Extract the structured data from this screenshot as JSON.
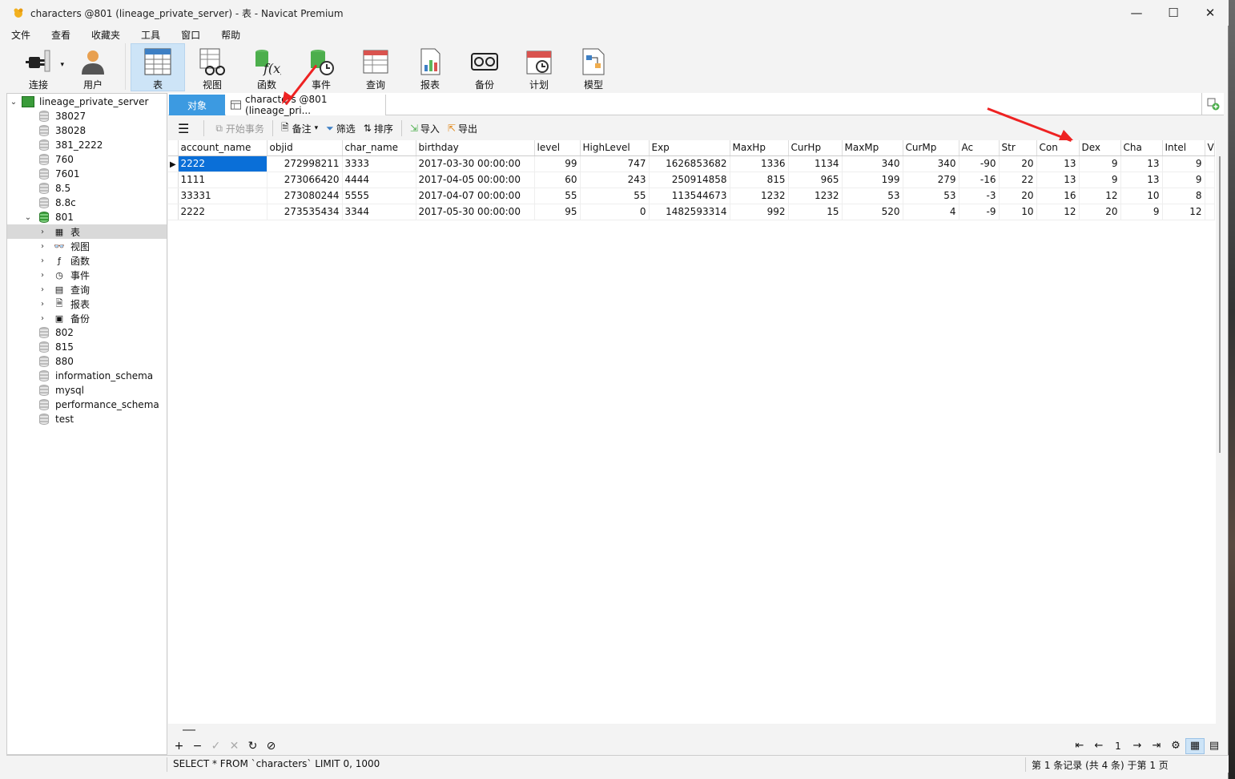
{
  "window": {
    "title": "characters @801 (lineage_private_server) - 表 - Navicat Premium",
    "min": "—",
    "max": "☐",
    "close": "✕"
  },
  "menu": [
    "文件",
    "查看",
    "收藏夹",
    "工具",
    "窗口",
    "帮助"
  ],
  "toolbar": {
    "connect": "连接",
    "user": "用户",
    "table": "表",
    "view": "视图",
    "function": "函数",
    "event": "事件",
    "query": "查询",
    "report": "报表",
    "backup": "备份",
    "schedule": "计划",
    "model": "模型"
  },
  "sidebar": {
    "root": "lineage_private_server",
    "dbs_top": [
      "38027",
      "38028",
      "381_2222",
      "760",
      "7601",
      "8.5",
      "8.8c"
    ],
    "current_db": "801",
    "children": [
      "表",
      "视图",
      "函数",
      "事件",
      "查询",
      "报表",
      "备份"
    ],
    "dbs_bottom": [
      "802",
      "815",
      "880",
      "information_schema",
      "mysql",
      "performance_schema",
      "test"
    ]
  },
  "tabs": {
    "objects": "对象",
    "current": "characters @801 (lineage_pri..."
  },
  "gridbar": {
    "begin_tx": "开始事务",
    "memo": "备注",
    "filter": "筛选",
    "sort": "排序",
    "import": "导入",
    "export": "导出"
  },
  "table": {
    "columns": [
      "account_name",
      "objid",
      "char_name",
      "birthday",
      "level",
      "HighLevel",
      "Exp",
      "MaxHp",
      "CurHp",
      "MaxMp",
      "CurMp",
      "Ac",
      "Str",
      "Con",
      "Dex",
      "Cha",
      "Intel",
      "V"
    ],
    "rows": [
      [
        "2222",
        "272998211",
        "3333",
        "2017-03-30 00:00:00",
        "99",
        "747",
        "1626853682",
        "1336",
        "1134",
        "340",
        "340",
        "-90",
        "20",
        "13",
        "9",
        "13",
        "9",
        ""
      ],
      [
        "1111",
        "273066420",
        "4444",
        "2017-04-05 00:00:00",
        "60",
        "243",
        "250914858",
        "815",
        "965",
        "199",
        "279",
        "-16",
        "22",
        "13",
        "9",
        "13",
        "9",
        ""
      ],
      [
        "33331",
        "273080244",
        "5555",
        "2017-04-07 00:00:00",
        "55",
        "55",
        "113544673",
        "1232",
        "1232",
        "53",
        "53",
        "-3",
        "20",
        "16",
        "12",
        "10",
        "8",
        ""
      ],
      [
        "2222",
        "273535434",
        "3344",
        "2017-05-30 00:00:00",
        "95",
        "0",
        "1482593314",
        "992",
        "15",
        "520",
        "4",
        "-9",
        "10",
        "12",
        "20",
        "9",
        "12",
        ""
      ]
    ]
  },
  "pager": {
    "page": "1"
  },
  "status": {
    "sql": "SELECT * FROM `characters` LIMIT 0, 1000",
    "records": "第 1 条记录 (共 4 条) 于第 1 页"
  },
  "colors": {
    "accent": "#3c9ae1",
    "selection": "#0a6fd8",
    "annotation": "#ee2222"
  }
}
